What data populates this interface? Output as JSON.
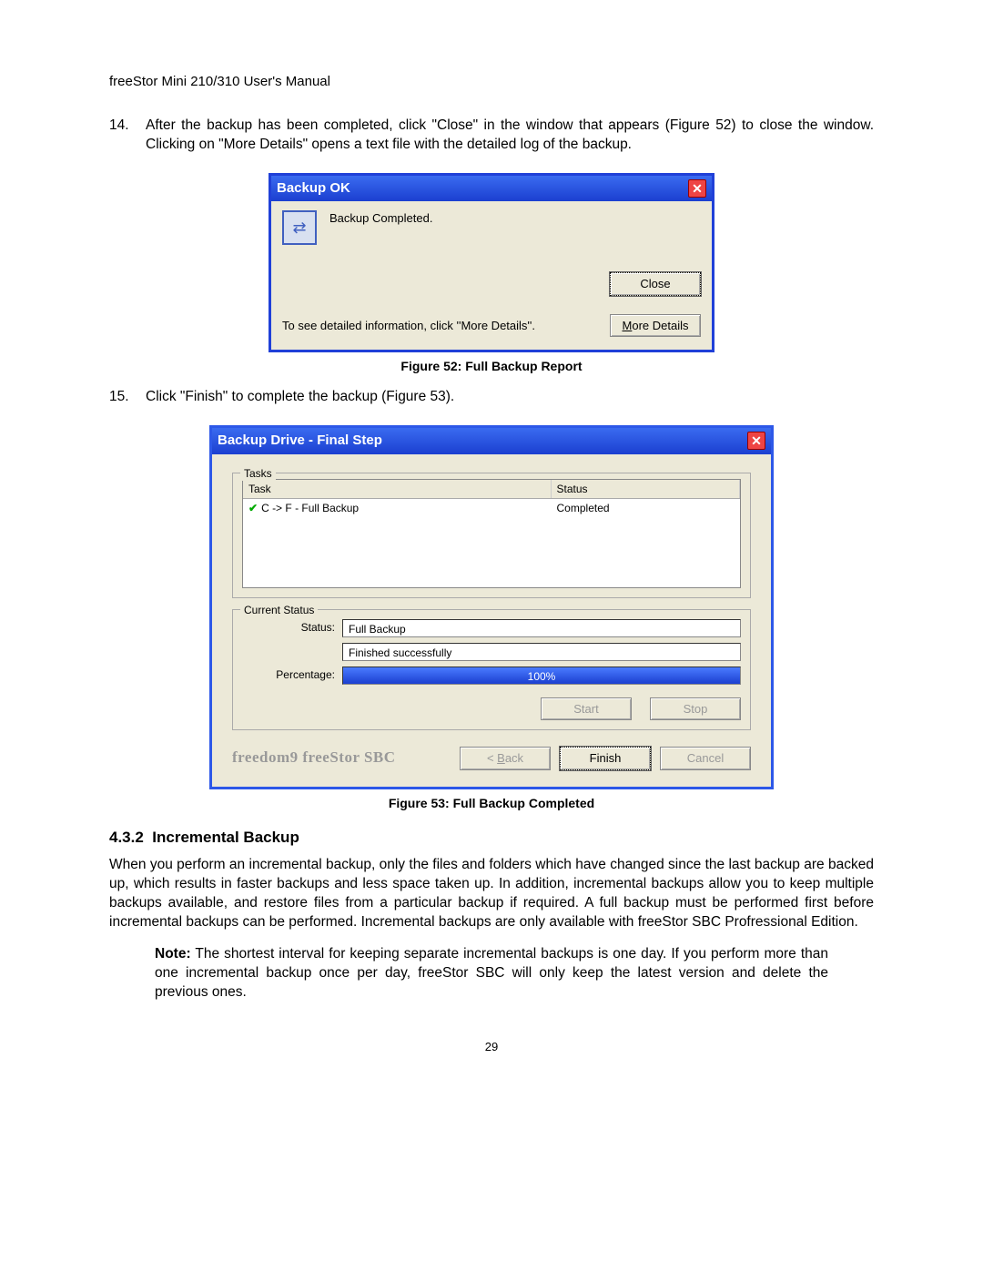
{
  "header": "freeStor Mini 210/310 User's Manual",
  "step14": {
    "num": "14.",
    "text": "After the backup has been completed, click \"Close\" in the window that appears (Figure 52) to close the window.  Clicking on \"More Details\" opens a text file with the detailed log of the backup."
  },
  "dlg1": {
    "title": "Backup OK",
    "message": "Backup Completed.",
    "closeBtn": "Close",
    "hint": "To see detailed information, click ''More Details''.",
    "moreBtnPre": "M",
    "moreBtnRest": "ore Details"
  },
  "caption52": "Figure 52: Full Backup Report",
  "step15": {
    "num": "15.",
    "text": "Click \"Finish\" to complete the backup (Figure 53)."
  },
  "dlg2": {
    "title": "Backup Drive - Final Step",
    "tasksLegend": "Tasks",
    "thTask": "Task",
    "thStatus": "Status",
    "rowTask": "C -> F - Full Backup",
    "rowStatus": "Completed",
    "curLegend": "Current Status",
    "statusLabel": "Status:",
    "statusVal1": "Full Backup",
    "statusVal2": "Finished successfully",
    "pctLabel": "Percentage:",
    "pctText": "100%",
    "start": "Start",
    "stop": "Stop",
    "brand": "freedom9 freeStor SBC",
    "backPre": "< ",
    "backU": "B",
    "backRest": "ack",
    "finish": "Finish",
    "cancel": "Cancel"
  },
  "caption53": "Figure 53: Full Backup Completed",
  "section": {
    "num": "4.3.2",
    "title": "Incremental Backup"
  },
  "para1": "When you perform an incremental backup, only the files and folders which have changed since the last backup are backed up, which results in faster backups and less space taken up.  In addition, incremental backups allow you to keep multiple backups available, and restore files from a particular backup if required.  A full backup must be performed first before incremental backups can be performed.   Incremental backups are only available with freeStor SBC Profressional Edition.",
  "note": {
    "label": "Note:",
    "text": " The shortest interval for keeping separate incremental backups is one day.  If you perform more than one incremental backup once per day, freeStor SBC will only keep the latest version and delete the previous ones."
  },
  "pageNum": "29"
}
